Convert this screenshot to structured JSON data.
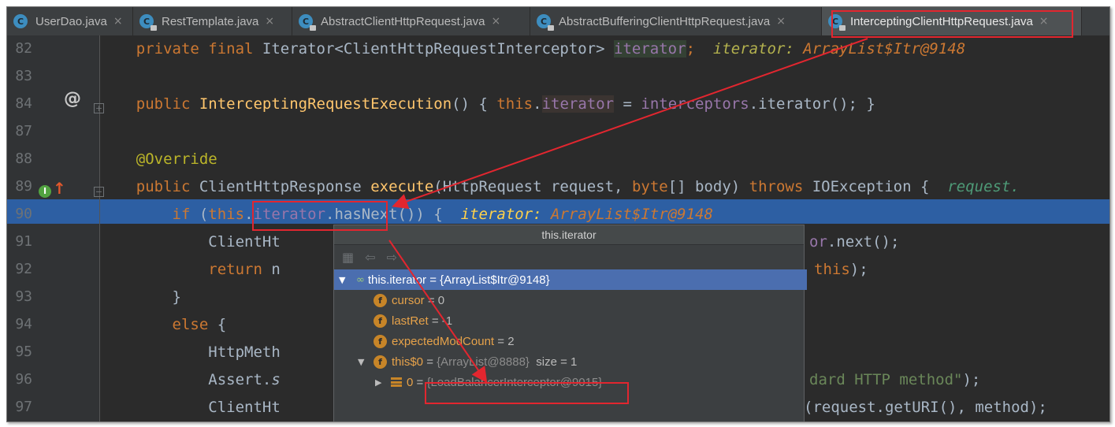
{
  "tabs": [
    {
      "label": "UserDao.java",
      "icon": "class-icon",
      "locked": false
    },
    {
      "label": "RestTemplate.java",
      "icon": "class-icon",
      "locked": true
    },
    {
      "label": "AbstractClientHttpRequest.java",
      "icon": "class-icon",
      "locked": true
    },
    {
      "label": "AbstractBufferingClientHttpRequest.java",
      "icon": "class-icon",
      "locked": true
    },
    {
      "label": "InterceptingClientHttpRequest.java",
      "icon": "class-icon",
      "locked": true,
      "active": true
    }
  ],
  "close_glyph": "×",
  "line_numbers": [
    "82",
    "83",
    "84",
    "87",
    "88",
    "89",
    "90",
    "91",
    "92",
    "93",
    "94",
    "95",
    "96",
    "97"
  ],
  "gutter": {
    "override_marker": "@",
    "impl_marker": "I",
    "impl_arrow": "↑"
  },
  "code": {
    "l82": {
      "indent": "    ",
      "kw": "private final ",
      "type": "Iterator<ClientHttpRequestInterceptor> ",
      "field": "iterator",
      "semi": ";  ",
      "hint_label": "iterator: ",
      "hint_val": "ArrayList$Itr@9148"
    },
    "l84": {
      "indent": "    ",
      "kw": "public ",
      "fn": "InterceptingRequestExecution",
      "paren": "() { ",
      "this": "this",
      "dot": ".",
      "field": "iterator",
      "eq": " = ",
      "field2": "interceptors",
      "rest": ".iterator(); }"
    },
    "l88": {
      "indent": "    ",
      "ann": "@Override"
    },
    "l89": {
      "indent": "    ",
      "kw": "public ",
      "type": "ClientHttpResponse ",
      "fn": "execute",
      "params_a": "(HttpRequest request, ",
      "kw2": "byte",
      "params_b": "[] body) ",
      "kw3": "throws ",
      "rest": "IOException {  ",
      "hint": "request."
    },
    "l90": {
      "indent": "        ",
      "kw": "if ",
      "open": "(",
      "this": "this",
      "dot": ".",
      "field": "iterator",
      "rest": ".hasNext()) {  ",
      "hint_label": "iterator: ",
      "hint_val": "ArrayList$Itr@9148"
    },
    "l91": {
      "indent": "            ",
      "text": "ClientHt",
      "tail_field": "or",
      "tail": ".next();"
    },
    "l92": {
      "indent": "            ",
      "kw": "return ",
      "text": "n",
      "tail_kw": "this",
      "tail": ");"
    },
    "l93": {
      "indent": "        ",
      "text": "}"
    },
    "l94": {
      "indent": "        ",
      "kw": "else ",
      "text": "{"
    },
    "l95": {
      "indent": "            ",
      "text": "HttpMeth"
    },
    "l96": {
      "indent": "            ",
      "text": "Assert.",
      "italic": "s",
      "tail_str": "dard HTTP method\"",
      "tail": ");"
    },
    "l97": {
      "indent": "            ",
      "text": "ClientHt",
      "tail": "(request.getURI(), method);"
    }
  },
  "popup": {
    "title": "this.iterator",
    "tree": [
      {
        "name": "this.iterator",
        "value": " = {ArrayList$Itr@9148}",
        "expanded": true,
        "selected": true
      },
      {
        "name": "cursor",
        "value": " = 0"
      },
      {
        "name": "lastRet",
        "value": " = -1"
      },
      {
        "name": "expectedModCount",
        "value": " = 2"
      },
      {
        "name": "this$0",
        "value": " = ",
        "value_gray": "{ArrayList@8888}",
        "extra": "  size = 1",
        "expanded": true
      },
      {
        "name": "0",
        "value": " = ",
        "value_gray": "{LoadBalancerInterceptor@9015}",
        "expanded": false
      }
    ]
  },
  "colors": {
    "accent_red": "#e2262f",
    "selection_blue": "#2d5fa3",
    "background": "#2b2b2b"
  }
}
